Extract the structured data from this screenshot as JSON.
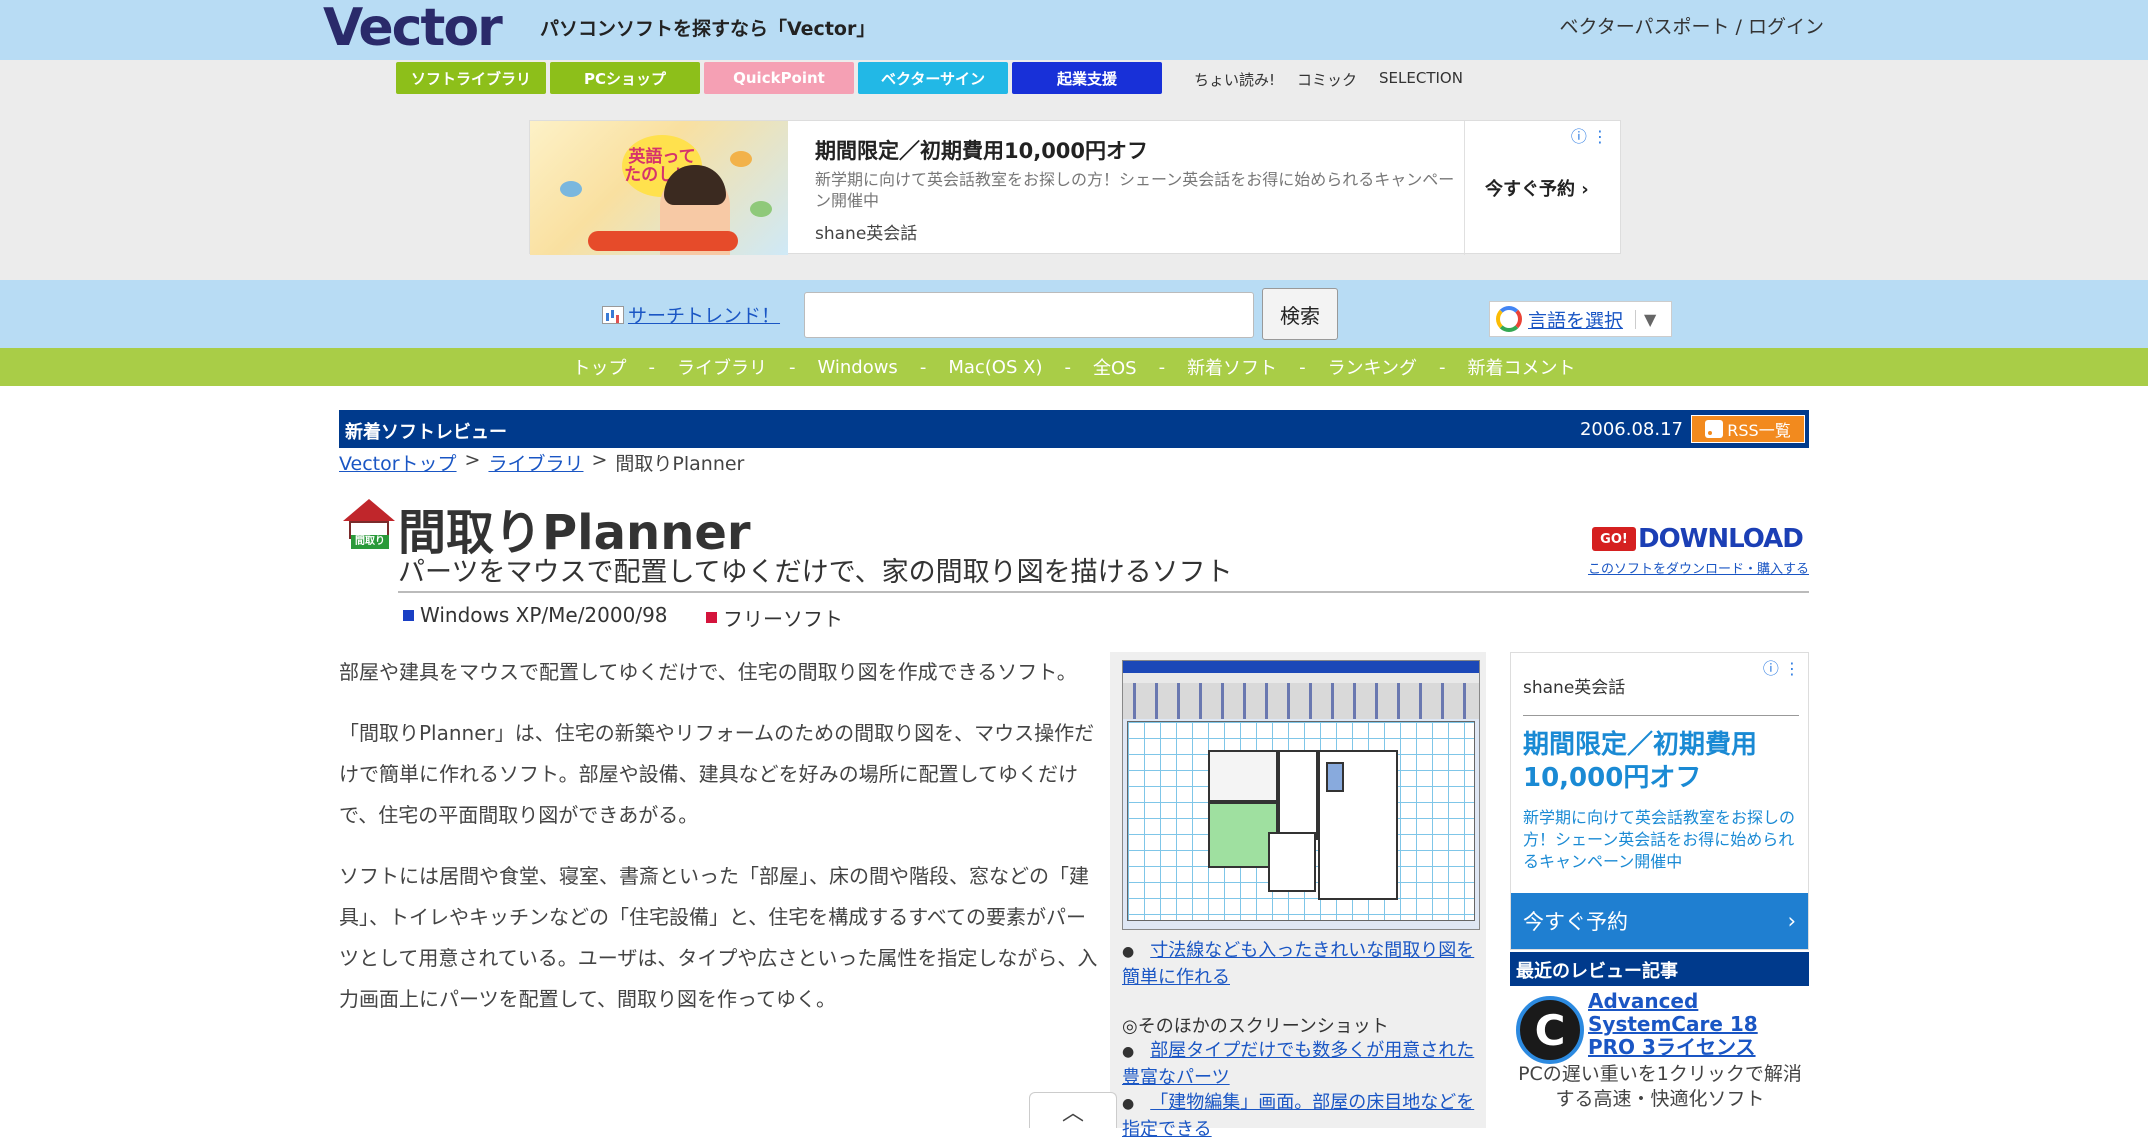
{
  "header": {
    "logo": "Vector",
    "tagline": "パソコンソフトを探すなら「Vector」",
    "login": "ベクターパスポート / ログイン"
  },
  "category_tabs": [
    {
      "label": "ソフトライブラリ",
      "color": "#8dbf1a"
    },
    {
      "label": "PCショップ",
      "color": "#8dbf1a"
    },
    {
      "label": "QuickPoint",
      "color": "#f5a0b4"
    },
    {
      "label": "ベクターサイン",
      "color": "#22b8e6"
    },
    {
      "label": "起業支援",
      "color": "#1830d8"
    }
  ],
  "sublinks": [
    "ちょい読み!",
    "コミック",
    "SELECTION"
  ],
  "top_ad": {
    "image_text": "英語ってたのしい!",
    "title": "期間限定／初期費用10,000円オフ",
    "description": "新学期に向けて英会話教室をお探しの方！シェーン英会話をお得に始められるキャンペーン開催中",
    "brand": "shane英会話",
    "cta": "今すぐ予約",
    "info_icon": "info-icon"
  },
  "search": {
    "trend_label": "サーチトレンド！",
    "placeholder": "",
    "button": "検索",
    "translate_label": "言語を選択"
  },
  "nav": [
    "トップ",
    "ライブラリ",
    "Windows",
    "Mac(OS X)",
    "全OS",
    "新着ソフト",
    "ランキング",
    "新着コメント"
  ],
  "review_bar": {
    "label": "新着ソフトレビュー",
    "date": "2006.08.17",
    "rss": "RSS一覧"
  },
  "breadcrumb": {
    "items": [
      "Vectorトップ",
      "ライブラリ"
    ],
    "separator": ">",
    "current": "間取りPlanner"
  },
  "software": {
    "title": "間取りPlanner",
    "icon_label": "間取り",
    "subtitle": "パーツをマウスで配置してゆくだけで、家の間取り図を描けるソフト",
    "platform": "Windows XP/Me/2000/98",
    "license": "フリーソフト",
    "download_go": "GO!",
    "download_label": "DOWNLOAD",
    "download_sub": "このソフトをダウンロード・購入する"
  },
  "body_paragraphs": [
    "部屋や建具をマウスで配置してゆくだけで、住宅の間取り図を作成できるソフト。",
    "「間取りPlanner」は、住宅の新築やリフォームのための間取り図を、マウス操作だけで簡単に作れるソフト。部屋や設備、建具などを好みの場所に配置してゆくだけで、住宅の平面間取り図ができあがる。",
    "ソフトには居間や食堂、寝室、書斎といった「部屋」、床の間や階段、窓などの「建具」、トイレやキッチンなどの「住宅設備」と、住宅を構成するすべての要素がパーツとして用意されている。ユーザは、タイプや広さといった属性を指定しながら、入力画面上にパーツを配置して、間取り図を作ってゆく。"
  ],
  "screenshot": {
    "caption": "寸法線なども入ったきれいな間取り図を簡単に作れる",
    "more_label": "◎そのほかのスクリーンショット",
    "more_items": [
      "部屋タイプだけでも数多くが用意された豊富なパーツ",
      "「建物編集」画面。部屋の床目地などを指定できる"
    ]
  },
  "side_ad": {
    "brand": "shane英会話",
    "headline": "期間限定／初期費用10,000円オフ",
    "description": "新学期に向けて英会話教室をお探しの方！シェーン英会話をお得に始められるキャンペーン開催中",
    "cta": "今すぐ予約"
  },
  "recent_reviews": {
    "header": "最近のレビュー記事",
    "item_title": "Advanced SystemCare 18 PRO 3ライセンス",
    "item_desc": "PCの遅い重いを1クリックで解消する高速・快適化ソフト"
  },
  "colors": {
    "header_bg": "#b8dcf4",
    "nav_bg": "#a9cd47",
    "review_bar_bg": "#003a8c",
    "link": "#1a56c4",
    "platform_square": "#1a3fc4",
    "license_square": "#d4143c"
  }
}
